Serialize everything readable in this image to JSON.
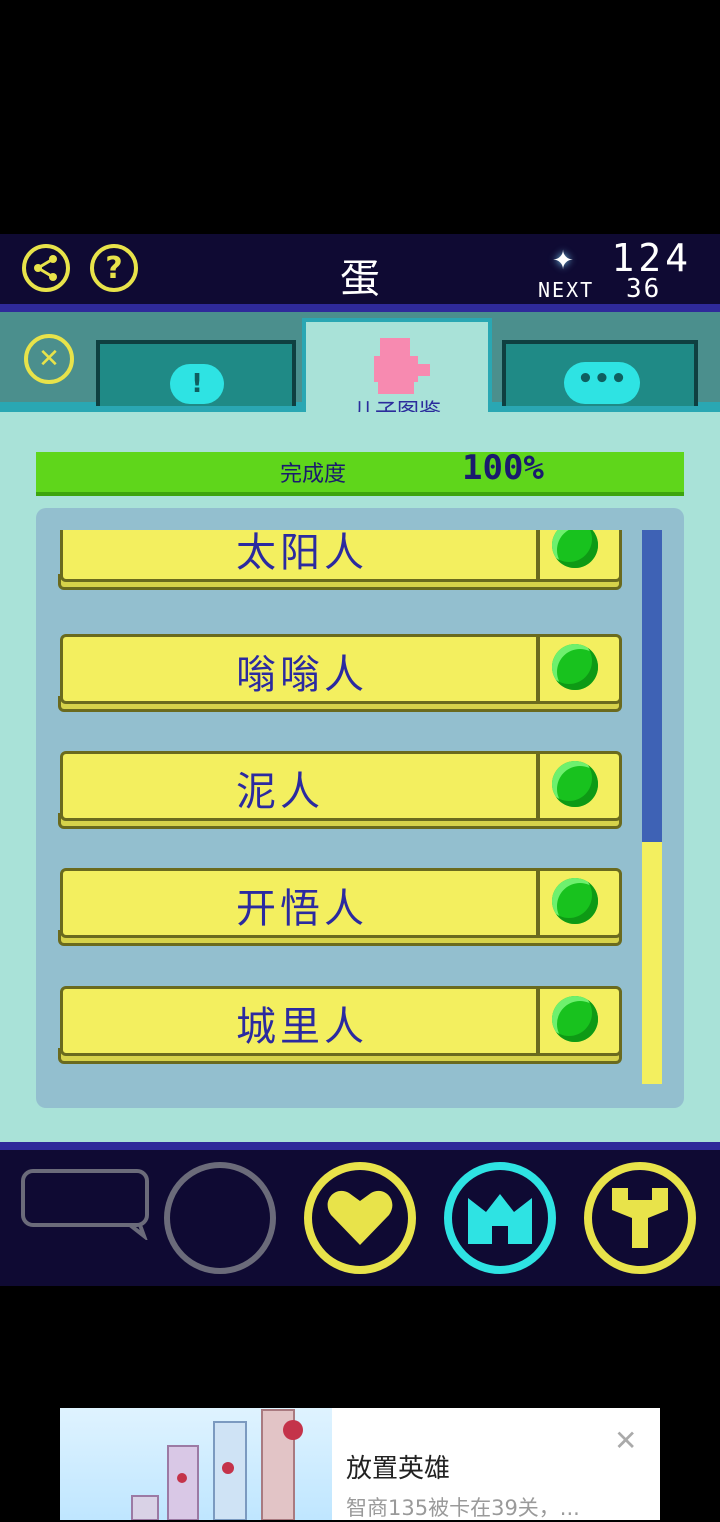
{
  "header": {
    "title": "蛋",
    "gem_count": "124",
    "next_label": "NEXT",
    "next_value": "36",
    "share_icon": "share-icon",
    "help_icon": "help-icon"
  },
  "tabs": {
    "active_label": "儿子图鉴",
    "items": [
      "info-tab",
      "son-encyclopedia-tab",
      "chat-tab"
    ]
  },
  "progress": {
    "label": "完成度",
    "value_text": "100%",
    "value": 1.0
  },
  "list": {
    "items": [
      {
        "name": "太阳人",
        "unlocked": true
      },
      {
        "name": "嗡嗡人",
        "unlocked": true
      },
      {
        "name": "泥人",
        "unlocked": true
      },
      {
        "name": "开悟人",
        "unlocked": true
      },
      {
        "name": "城里人",
        "unlocked": true
      }
    ],
    "scroll_position": 0.56
  },
  "bottom_nav": {
    "items": [
      "speech-bubble-icon",
      "empty-circle-icon",
      "heart-icon",
      "crown-icon",
      "wrench-icon"
    ]
  },
  "ad": {
    "title": "放置英雄",
    "subtitle": "智商135被卡在39关，..."
  },
  "colors": {
    "accent_yellow": "#e8e34a",
    "panel": "#a9e2d8",
    "header": "#0f0a33",
    "progress_green": "#5fd61b",
    "text_blue": "#2b2aa0"
  }
}
